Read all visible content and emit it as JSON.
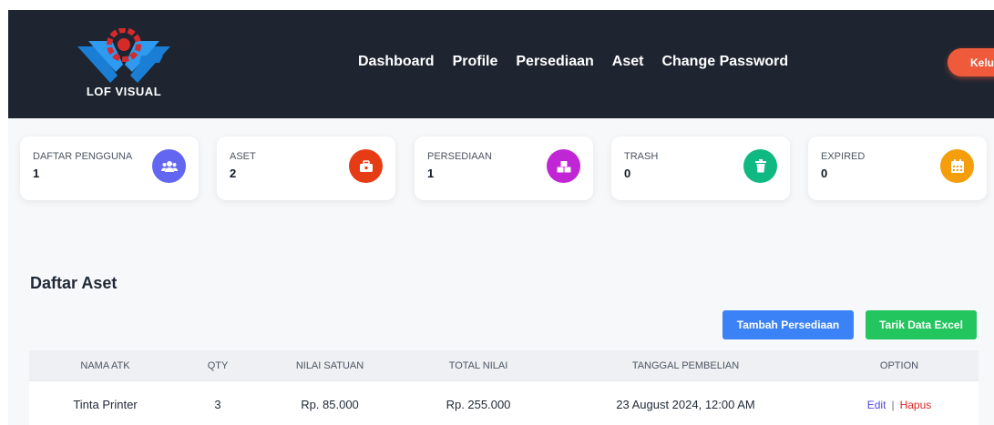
{
  "brand": {
    "logo_text": "LOF VISUAL"
  },
  "nav": {
    "links": [
      "Dashboard",
      "Profile",
      "Persediaan",
      "Aset",
      "Change Password"
    ],
    "logout_label": "Keluar"
  },
  "stats": [
    {
      "label": "DAFTAR PENGGUNA",
      "value": "1",
      "icon": "users-icon",
      "color": "#6366f1"
    },
    {
      "label": "ASET",
      "value": "2",
      "icon": "toolbox-icon",
      "color": "#e63c16"
    },
    {
      "label": "PERSEDIAAN",
      "value": "1",
      "icon": "boxes-icon",
      "color": "#c026d3"
    },
    {
      "label": "TRASH",
      "value": "0",
      "icon": "trash-icon",
      "color": "#10b981"
    },
    {
      "label": "EXPIRED",
      "value": "0",
      "icon": "calendar-icon",
      "color": "#f59e0b"
    }
  ],
  "main": {
    "title": "Daftar Aset",
    "add_button": "Tambah Persediaan",
    "export_button": "Tarik Data Excel"
  },
  "table": {
    "headers": [
      "NAMA ATK",
      "QTY",
      "NILAI SATUAN",
      "TOTAL NILAI",
      "TANGGAL PEMBELIAN",
      "OPTION"
    ],
    "rows": [
      {
        "nama": "Tinta Printer",
        "qty": "3",
        "nilai_satuan": "Rp. 85.000",
        "total_nilai": "Rp. 255.000",
        "tanggal": "23 August 2024, 12:00 AM",
        "edit": "Edit",
        "sep": "|",
        "hapus": "Hapus"
      }
    ]
  }
}
